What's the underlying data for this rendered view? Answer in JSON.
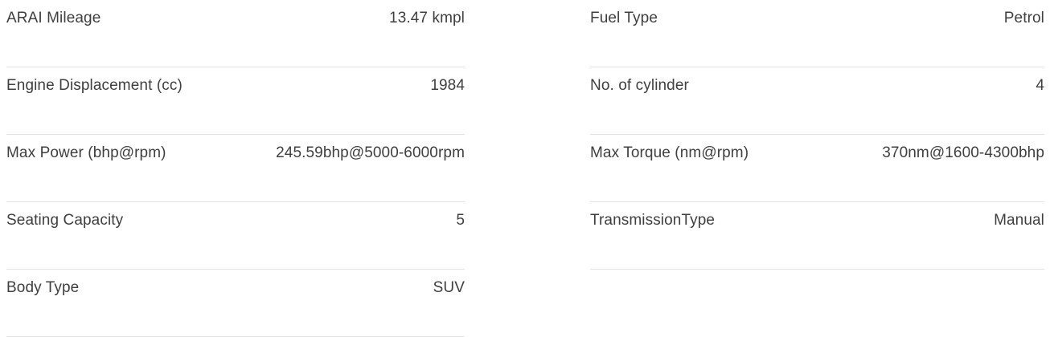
{
  "specs": {
    "left": [
      {
        "label": "ARAI Mileage",
        "value": "13.47 kmpl"
      },
      {
        "label": "Engine Displacement (cc)",
        "value": "1984"
      },
      {
        "label": "Max Power (bhp@rpm)",
        "value": "245.59bhp@5000-6000rpm"
      },
      {
        "label": "Seating Capacity",
        "value": "5"
      },
      {
        "label": "Body Type",
        "value": "SUV"
      }
    ],
    "right": [
      {
        "label": "Fuel Type",
        "value": "Petrol"
      },
      {
        "label": "No. of cylinder",
        "value": "4"
      },
      {
        "label": "Max Torque (nm@rpm)",
        "value": "370nm@1600-4300bhp"
      },
      {
        "label": "TransmissionType",
        "value": "Manual"
      }
    ]
  }
}
